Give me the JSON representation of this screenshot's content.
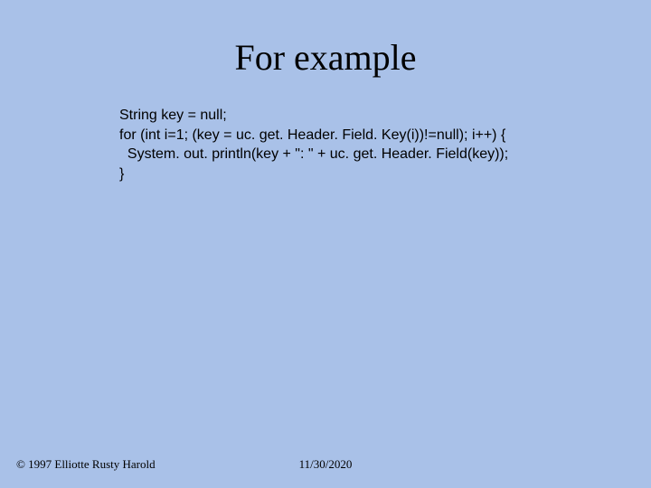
{
  "title": "For example",
  "code": {
    "line1": "String key = null;",
    "line2": "for (int i=1; (key = uc. get. Header. Field. Key(i))!=null); i++) {",
    "line3": "  System. out. println(key + \": \" + uc. get. Header. Field(key));",
    "line4": "}"
  },
  "footer": {
    "left": "© 1997 Elliotte Rusty Harold",
    "center": "11/30/2020"
  }
}
